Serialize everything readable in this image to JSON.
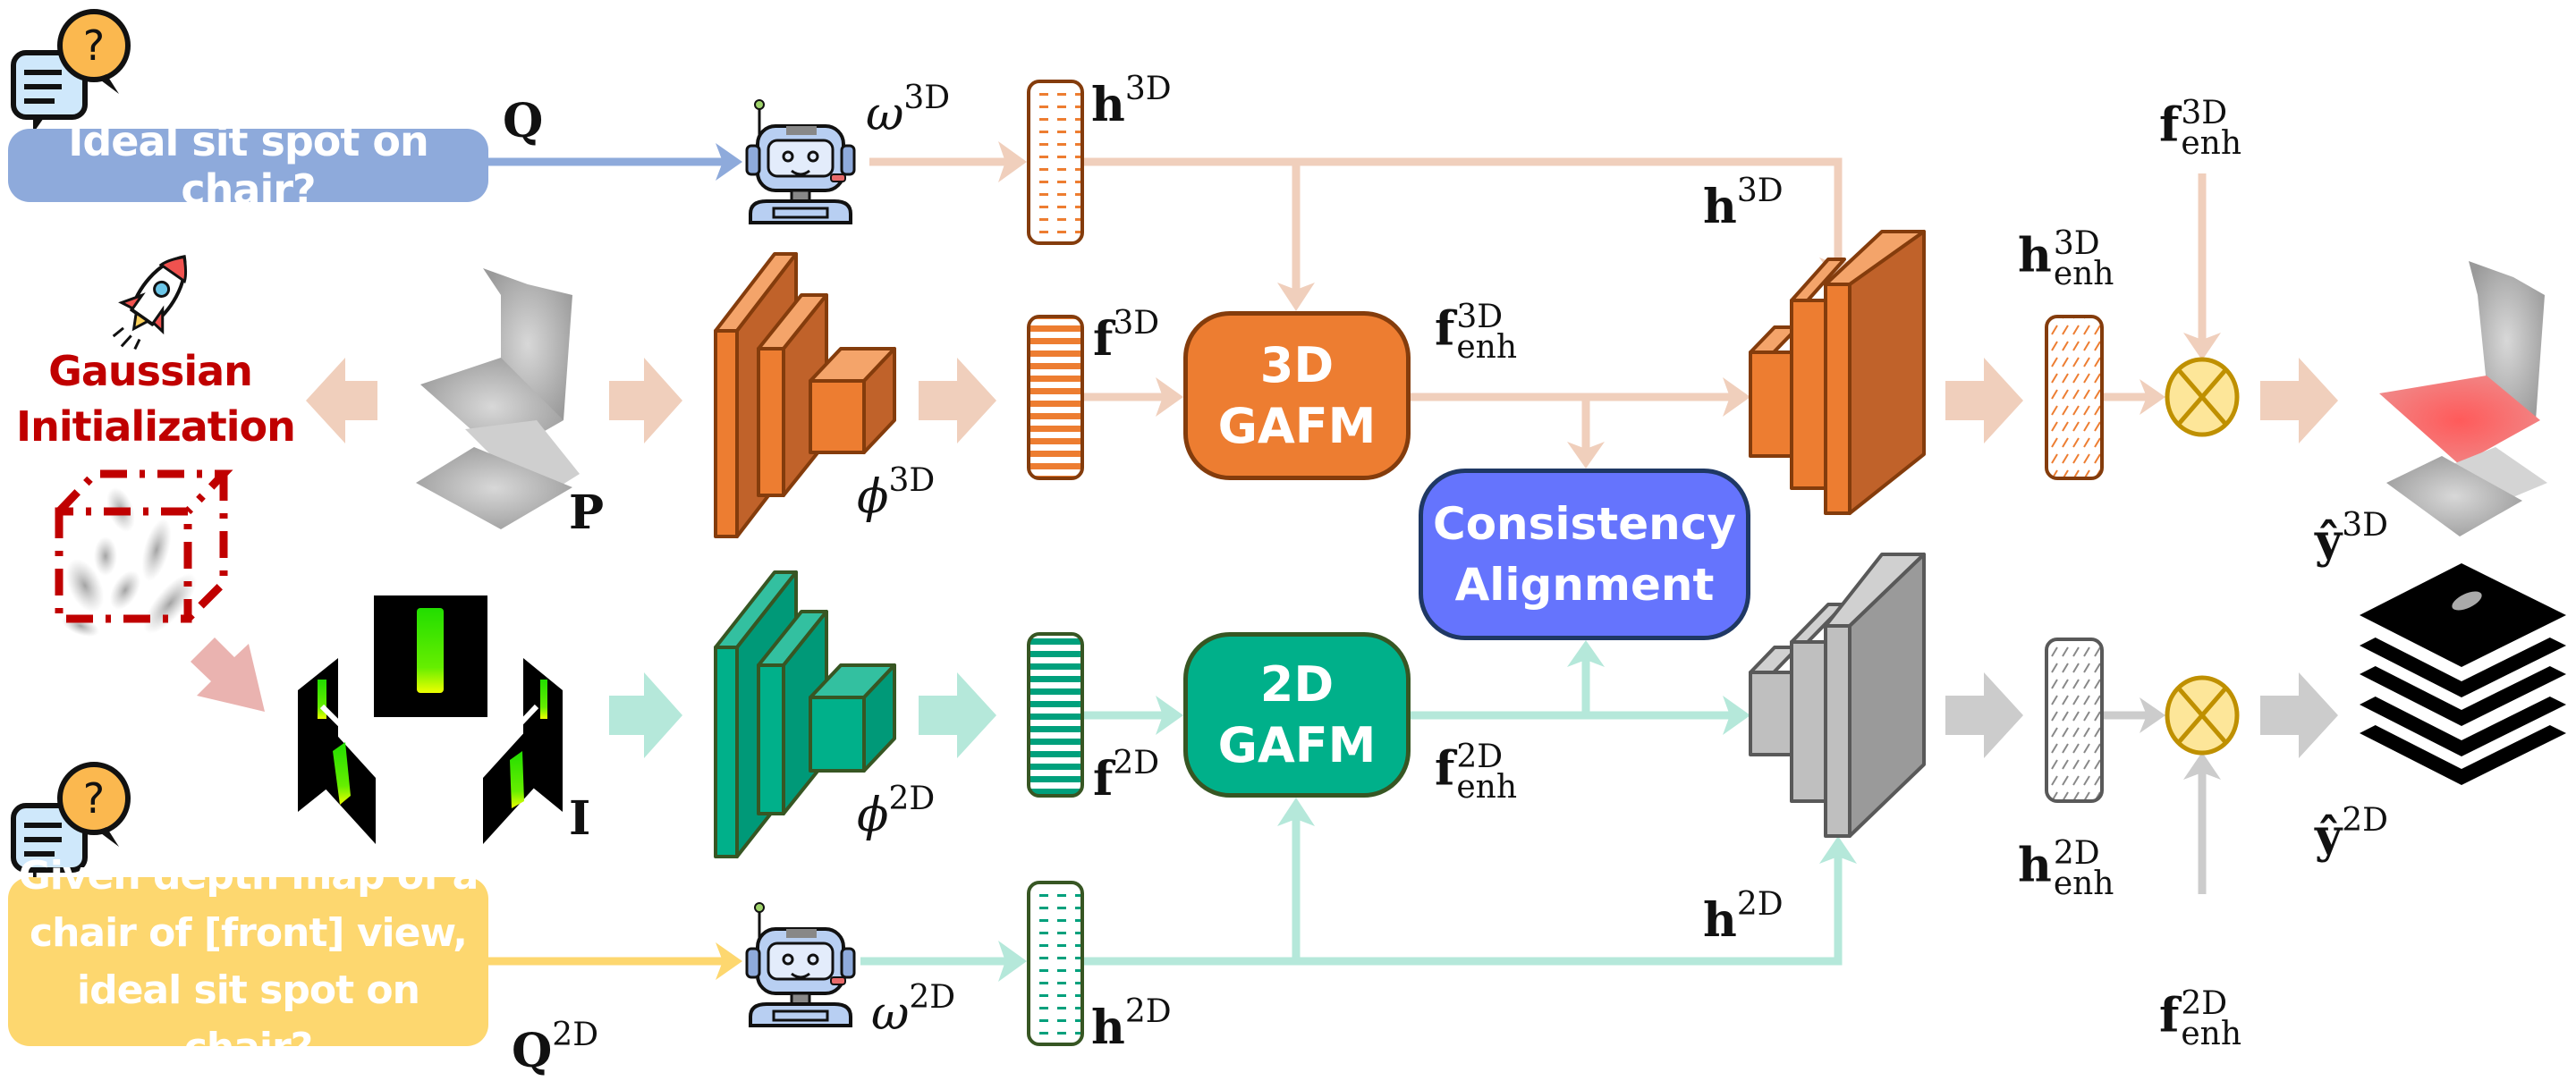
{
  "queries": {
    "q3d_text": "Ideal sit spot on chair?",
    "q2d_lines": [
      "Given depth map of a",
      "chair of [front] view,",
      "ideal sit spot on chair?"
    ]
  },
  "labels": {
    "Q": "Q",
    "Q2D_base": "Q",
    "Q2D_sup": "2D",
    "omega": "ω",
    "phi": "ϕ",
    "h": "h",
    "f": "f",
    "y": "ŷ",
    "P": "P",
    "I": "I",
    "sup3d": "3D",
    "sup2d": "2D",
    "enh": "enh"
  },
  "left": {
    "gaussian_line1": "Gaussian",
    "gaussian_line2": "Initialization"
  },
  "modules": {
    "gafm3d_line1": "3D",
    "gafm3d_line2": "GAFM",
    "gafm2d_line1": "2D",
    "gafm2d_line2": "GAFM",
    "ca_line1": "Consistency",
    "ca_line2": "Alignment"
  },
  "icons": {
    "chat_question": "chat-question-icon",
    "robot": "robot-icon",
    "rocket": "rocket-icon",
    "otimes": "otimes-icon"
  },
  "colors": {
    "branch3d_line": "#f0cfbc",
    "branch2d_line": "#b5e8da",
    "gray_line": "#cccccc",
    "query_blue": "#8eaadb",
    "query_yellow": "#fdd76f",
    "orange": "#ed7d31",
    "orange_dark": "#843c0c",
    "teal": "#00b08a",
    "teal_dark": "#375623",
    "ca_blue": "#6574fd",
    "gauss_red": "#c00000",
    "pink_arrow": "#eab3b0"
  }
}
